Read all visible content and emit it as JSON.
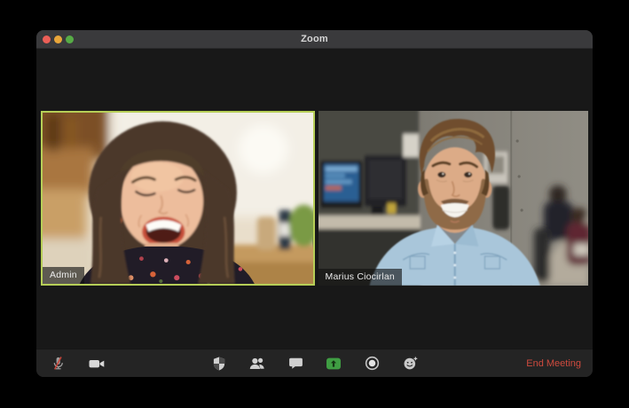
{
  "window": {
    "title": "Zoom"
  },
  "titlebar": {
    "controls": [
      {
        "name": "close",
        "color": "#ec5f57"
      },
      {
        "name": "minimize",
        "color": "#e9a63a"
      },
      {
        "name": "zoom",
        "color": "#57ac46"
      }
    ]
  },
  "tiles": [
    {
      "name": "Admin",
      "active_speaker": true
    },
    {
      "name": "Marius Ciocirlan",
      "active_speaker": false
    }
  ],
  "toolbar": {
    "left_buttons": [
      {
        "icon": "microphone-muted-icon",
        "muted": true
      },
      {
        "icon": "video-camera-icon"
      }
    ],
    "center_buttons": [
      {
        "icon": "security-shield-icon"
      },
      {
        "icon": "participants-icon"
      },
      {
        "icon": "chat-icon"
      },
      {
        "icon": "share-screen-icon",
        "highlighted": true
      },
      {
        "icon": "record-icon"
      },
      {
        "icon": "reactions-icon"
      }
    ],
    "end_meeting_label": "End Meeting"
  },
  "colors": {
    "active_speaker_border": "#b6ce57",
    "share_screen_green": "#3f9e43",
    "end_meeting_red": "#ce4a3e",
    "mute_slash_red": "#c8473c",
    "titlebar_bg": "#3a3a3c",
    "toolbar_bg": "#242424",
    "window_bg": "#181818"
  }
}
